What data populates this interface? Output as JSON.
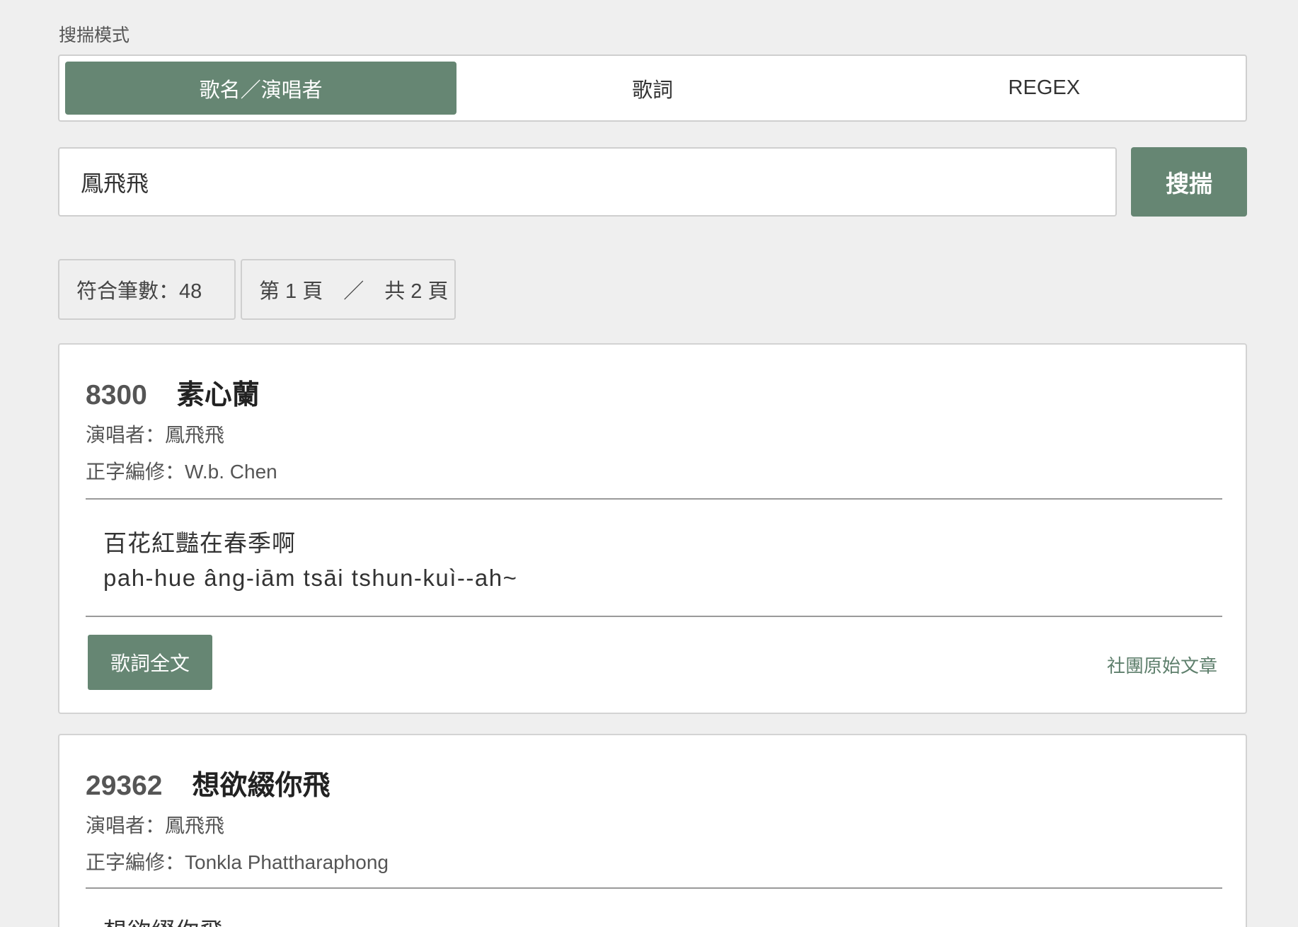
{
  "search_mode": {
    "label": "搜揣模式",
    "tabs": [
      {
        "label": "歌名／演唱者",
        "active": true
      },
      {
        "label": "歌詞",
        "active": false
      },
      {
        "label": "REGEX",
        "active": false
      }
    ]
  },
  "search": {
    "value": "鳳飛飛",
    "button_label": "搜揣"
  },
  "stats": {
    "count_text": "符合筆數：48",
    "page_text": "第 1 頁　／　共 2 頁"
  },
  "results": [
    {
      "id": "8300",
      "title": "素心蘭",
      "singer": "演唱者：鳳飛飛",
      "editor": "正字編修：W.b. Chen",
      "lyric_han": "百花紅豔在春季啊",
      "lyric_roman": "pah-hue âng-iām tsāi tshun-kuì--ah~",
      "full_lyrics_label": "歌詞全文",
      "source_label": "社團原始文章"
    },
    {
      "id": "29362",
      "title": "想欲綴你飛",
      "singer": "演唱者：鳳飛飛",
      "editor": "正字編修：Tonkla Phattharaphong",
      "lyric_han": "想欲綴你飛"
    }
  ],
  "colors": {
    "accent": "#668673",
    "background": "#efefef",
    "link": "#5e7f6c"
  }
}
